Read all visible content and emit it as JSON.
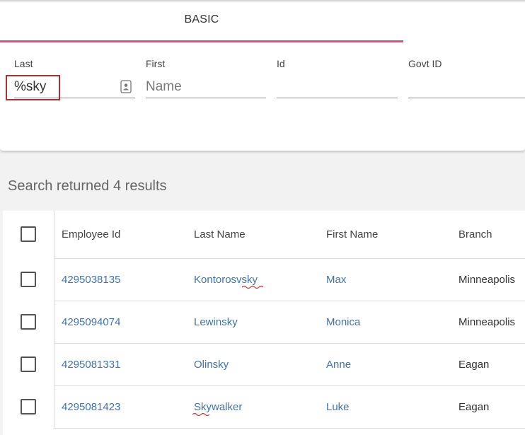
{
  "tabs": [
    {
      "label": "BASIC",
      "active": true
    }
  ],
  "fields": {
    "last": {
      "label": "Last",
      "value": "%sky",
      "placeholder": ""
    },
    "first": {
      "label": "First",
      "value": "",
      "placeholder": "Name"
    },
    "id": {
      "label": "Id",
      "value": "",
      "placeholder": ""
    },
    "govt_id": {
      "label": "Govt ID",
      "value": "",
      "placeholder": ""
    }
  },
  "results": {
    "caption": "Search returned 4 results"
  },
  "table": {
    "columns": [
      "Employee Id",
      "Last Name",
      "First Name",
      "Branch"
    ],
    "rows": [
      {
        "employee_id": "4295038135",
        "last_name": "Kontorosvsky",
        "first_name": "Max",
        "branch": "Minneapolis"
      },
      {
        "employee_id": "4295094074",
        "last_name": "Lewinsky",
        "first_name": "Monica",
        "branch": "Minneapolis"
      },
      {
        "employee_id": "4295081331",
        "last_name": "Olinsky",
        "first_name": "Anne",
        "branch": "Eagan"
      },
      {
        "employee_id": "4295081423",
        "last_name": "Skywalker",
        "first_name": "Luke",
        "branch": "Eagan"
      }
    ]
  },
  "colors": {
    "accent": "#e8478b",
    "link": "#3f73b0",
    "highlight_border": "#b03030",
    "spellcheck": "#d03030"
  },
  "icons": {
    "last_field_icon": "contact-card-icon"
  }
}
